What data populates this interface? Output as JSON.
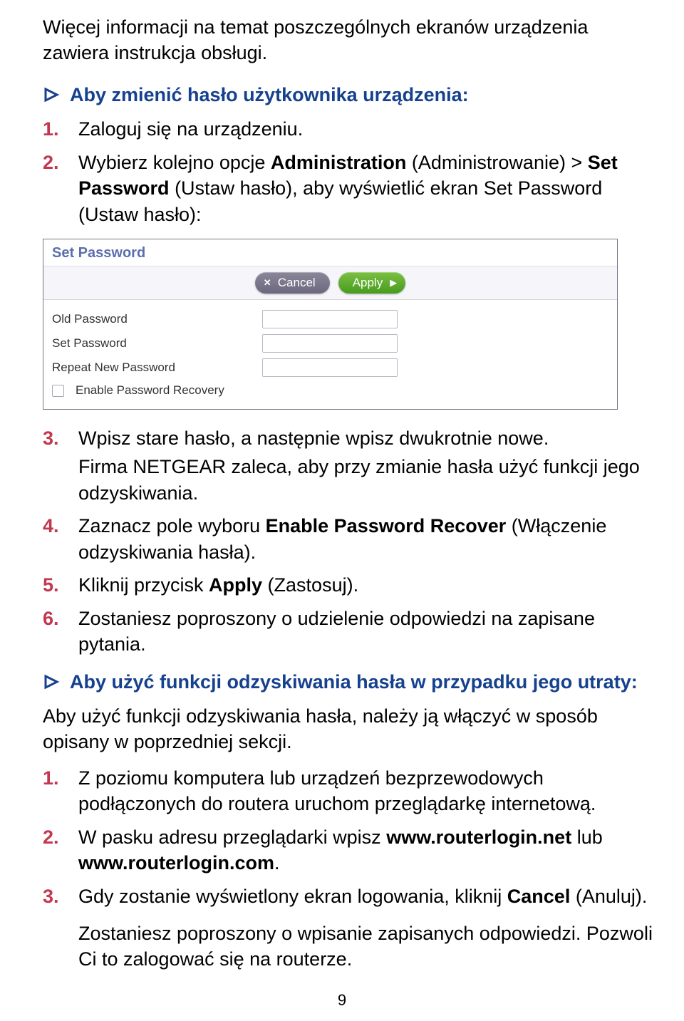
{
  "intro": "Więcej informacji na temat poszczególnych ekranów urządzenia zawiera instrukcja obsługi.",
  "section1": {
    "heading": "Aby zmienić hasło użytkownika urządzenia:",
    "items": [
      {
        "num": "1.",
        "text": "Zaloguj się na urządzeniu."
      },
      {
        "num": "2.",
        "prefix": "Wybierz kolejno opcje ",
        "b1": "Administration",
        "mid1": " (Administrowanie) > ",
        "b2": "Set Password",
        "mid2": " (Ustaw hasło), aby wyświetlić ekran Set Password (Ustaw hasło):"
      }
    ]
  },
  "screenshot": {
    "title": "Set Password",
    "cancel": "Cancel",
    "apply": "Apply",
    "old_pw": "Old Password",
    "set_pw": "Set Password",
    "repeat_pw": "Repeat New Password",
    "enable_recovery": "Enable Password Recovery"
  },
  "section1cont": [
    {
      "num": "3.",
      "text": "Wpisz stare hasło, a następnie wpisz dwukrotnie nowe.",
      "sub": "Firma NETGEAR zaleca, aby przy zmianie hasła użyć funkcji jego odzyskiwania."
    },
    {
      "num": "4.",
      "prefix": "Zaznacz pole wyboru ",
      "b1": "Enable Password Recover",
      "suffix": " (Włączenie odzyskiwania hasła)."
    },
    {
      "num": "5.",
      "prefix": "Kliknij przycisk ",
      "b1": "Apply",
      "suffix": " (Zastosuj)."
    },
    {
      "num": "6.",
      "text": "Zostaniesz poproszony o udzielenie odpowiedzi na zapisane pytania."
    }
  ],
  "section2": {
    "heading": "Aby użyć funkcji odzyskiwania hasła w przypadku jego utraty:",
    "intro": "Aby użyć funkcji odzyskiwania hasła, należy ją włączyć w sposób opisany w poprzedniej sekcji.",
    "items": [
      {
        "num": "1.",
        "text": "Z poziomu komputera lub urządzeń bezprzewodowych podłączonych do routera uruchom przeglądarkę internetową."
      },
      {
        "num": "2.",
        "prefix": "W pasku adresu przeglądarki wpisz ",
        "b1": "www.routerlogin.net",
        "mid": " lub ",
        "b2": "www.routerlogin.com",
        "suffix": "."
      },
      {
        "num": "3.",
        "prefix": "Gdy zostanie wyświetlony ekran logowania, kliknij ",
        "b1": "Cancel",
        "suffix": " (Anuluj)."
      }
    ],
    "tail": "Zostaniesz poproszony o wpisanie zapisanych odpowiedzi. Pozwoli Ci to zalogować się na routerze."
  },
  "page_number": "9"
}
